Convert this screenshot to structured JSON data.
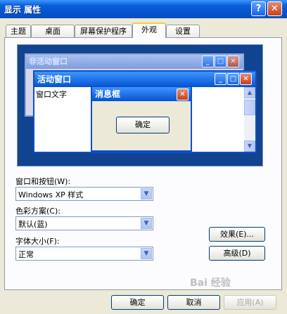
{
  "window": {
    "title": "显示 属性",
    "help_label": "?",
    "close_label": "✕"
  },
  "tabs": [
    {
      "label": "主题"
    },
    {
      "label": "桌面"
    },
    {
      "label": "屏幕保护程序"
    },
    {
      "label": "外观",
      "active": true
    },
    {
      "label": "设置"
    }
  ],
  "preview": {
    "inactive_window_title": "非活动窗口",
    "active_window_title": "活动窗口",
    "window_text": "窗口文字",
    "message_box_title": "消息框",
    "message_box_ok": "确定",
    "min_symbol": "_",
    "max_symbol": "□",
    "close_symbol": "✕"
  },
  "form": {
    "windows_buttons_label": "窗口和按钮(W):",
    "windows_buttons_value": "Windows XP 样式",
    "color_scheme_label": "色彩方案(C):",
    "color_scheme_value": "默认(蓝)",
    "font_size_label": "字体大小(F):",
    "font_size_value": "正常"
  },
  "buttons": {
    "effects": "效果(E)...",
    "advanced": "高级(D)",
    "ok": "确定",
    "cancel": "取消",
    "apply": "应用(A)"
  },
  "watermark": "Bai 经验",
  "colors": {
    "titlebar": "#0553d0",
    "preview_bg": "#12438e",
    "dialog_bg": "#ece9d8"
  }
}
